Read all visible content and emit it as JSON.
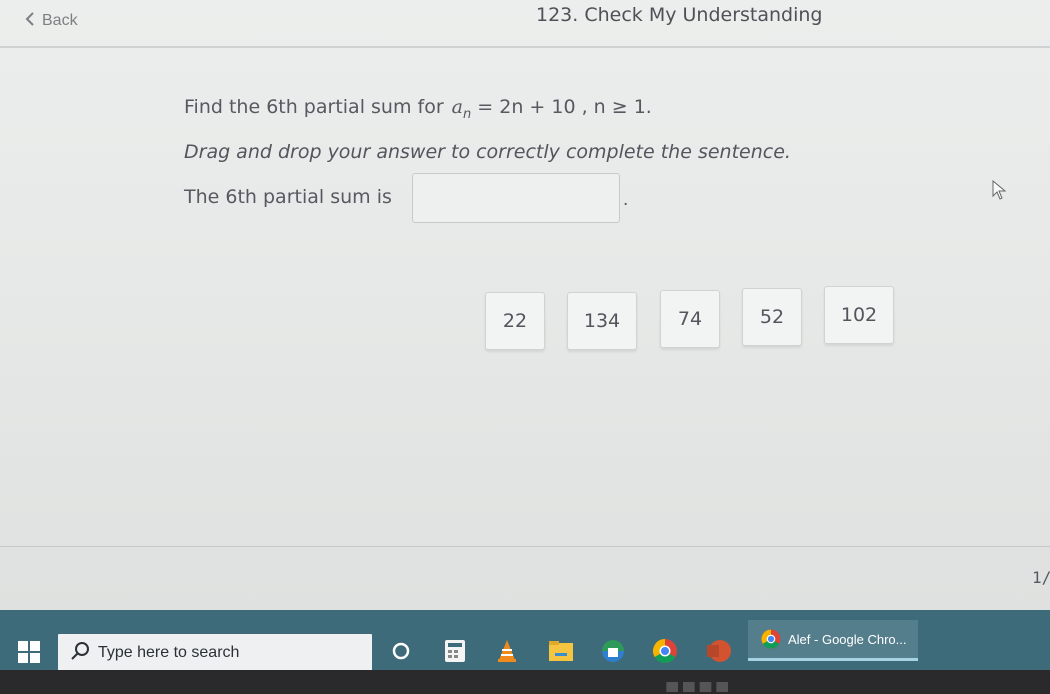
{
  "header": {
    "back_label": "Back",
    "title": "123. Check My Understanding"
  },
  "question": {
    "prompt": "Find the 6th partial sum for",
    "formula": {
      "term": "a",
      "subscript": "n",
      "rhs": "= 2n + 10 , n ≥ 1."
    },
    "instructions": "Drag and drop your answer to correctly complete the sentence.",
    "sentence_prefix": "The 6th partial sum is",
    "sentence_suffix": "."
  },
  "choices": [
    "22",
    "134",
    "74",
    "52",
    "102"
  ],
  "footer": {
    "page_indicator": "1/"
  },
  "taskbar": {
    "search_placeholder": "Type here to search",
    "active_app": "Alef - Google Chro..."
  },
  "colors": {
    "page_background": "#e8eaea",
    "taskbar": "#3e6b7a",
    "text": "#555a60"
  }
}
